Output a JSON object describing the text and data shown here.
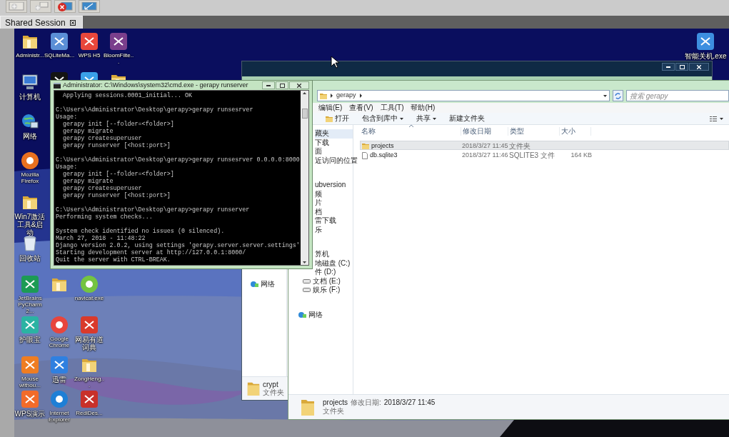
{
  "session_tabs": [
    {
      "label": "Shared Session",
      "selected": true
    }
  ],
  "desktop_icons": [
    {
      "label": "Administr...",
      "kind": "folder"
    },
    {
      "label": "SQLiteMa...",
      "kind": "tile",
      "color": "#5b8fd6"
    },
    {
      "label": "WPS H5",
      "kind": "tile",
      "color": "#e8473c"
    },
    {
      "label": "BloomFilte...",
      "kind": "tile",
      "color": "#7b3f8c"
    },
    {
      "label": "智能关机.exe",
      "kind": "tile",
      "color": "#3d8fe0"
    },
    {
      "label": "计算机",
      "kind": "computer"
    },
    {
      "kind": "tile",
      "color": "#141414"
    },
    {
      "kind": "tile",
      "color": "#3aa0e8"
    },
    {
      "kind": "folder"
    },
    {
      "label": "网络",
      "kind": "network"
    },
    {
      "label": "Mozilla Firefox",
      "kind": "round",
      "color": "#e8701f"
    },
    {
      "label": "Win7激活工具&启动",
      "kind": "folder"
    },
    {
      "label": "回收站",
      "kind": "recycle"
    },
    {
      "label": "JetBrains PyCharm 2...",
      "kind": "tile",
      "color": "#1c9b54"
    },
    {
      "kind": "folder"
    },
    {
      "label": "navicat.exe",
      "kind": "round",
      "color": "#74c441"
    },
    {
      "label": "护眼宝",
      "kind": "tile",
      "color": "#2bb3a3"
    },
    {
      "label": "Google Chrome",
      "kind": "round",
      "color": "#e8453c"
    },
    {
      "label": "网易有道词典",
      "kind": "tile",
      "color": "#d93a2b"
    },
    {
      "label": "Mouse withou...",
      "kind": "tile",
      "color": "#ef7d22"
    },
    {
      "label": "迅雷",
      "kind": "tile",
      "color": "#2f80e0"
    },
    {
      "label": "ZongHeng...",
      "kind": "folder"
    },
    {
      "label": "WPS演示",
      "kind": "tile",
      "color": "#f26b2a"
    },
    {
      "label": "Internet Explorer",
      "kind": "round",
      "color": "#1e7fd6"
    },
    {
      "label": "RediDes...",
      "kind": "tile",
      "color": "#c8312a"
    }
  ],
  "explorer_back": {
    "nav_items": [
      {
        "label": "网络",
        "kind": "network"
      }
    ],
    "details": {
      "name": "crypt",
      "type": "文件夹"
    }
  },
  "explorer": {
    "breadcrumb": [
      {
        "label": "gerapy"
      }
    ],
    "search": {
      "placeholder": "搜索 gerapy"
    },
    "menu": [
      "编辑(E)",
      "查看(V)",
      "工具(T)",
      "帮助(H)"
    ],
    "toolbar": [
      {
        "label": "打开",
        "kind": "open"
      },
      {
        "label": "包含到库中",
        "kind": "dropdown"
      },
      {
        "label": "共享",
        "kind": "dropdown"
      },
      {
        "label": "新建文件夹",
        "kind": "plain"
      }
    ],
    "nav_groups": [
      [
        {
          "label": "藏夹",
          "kind": "text",
          "selected": true
        },
        {
          "label": "下载",
          "kind": "text",
          "selected": false
        },
        {
          "label": "面",
          "kind": "text",
          "selected": false
        },
        {
          "label": "近访问的位置",
          "kind": "text",
          "selected": false
        }
      ],
      [
        {
          "label": "ubversion",
          "kind": "text",
          "selected": false
        },
        {
          "label": "频",
          "kind": "text",
          "selected": false
        },
        {
          "label": "片",
          "kind": "text",
          "selected": false
        },
        {
          "label": "档",
          "kind": "text",
          "selected": false
        },
        {
          "label": "雷下载",
          "kind": "text",
          "selected": false
        },
        {
          "label": "乐",
          "kind": "text",
          "selected": false
        }
      ],
      [
        {
          "label": "算机",
          "kind": "text",
          "selected": false
        },
        {
          "label": "地磁盘 (C:)",
          "kind": "text",
          "selected": false
        },
        {
          "label": "件 (D:)",
          "kind": "text",
          "selected": false
        },
        {
          "label": "文档 (E:)",
          "kind": "drive",
          "selected": false
        },
        {
          "label": "娱乐 (F:)",
          "kind": "drive",
          "selected": false
        }
      ],
      [
        {
          "label": "网络",
          "kind": "network",
          "selected": false
        }
      ]
    ],
    "columns": [
      "名称",
      "修改日期",
      "类型",
      "大小"
    ],
    "files": [
      {
        "name": "projects",
        "modified": "2018/3/27 11:45",
        "type": "文件夹",
        "kind": "folder",
        "selected": true
      },
      {
        "name": "db.sqlite3",
        "modified": "2018/3/27 11:46",
        "type": "SQLITE3 文件",
        "size": "164 KB",
        "kind": "file",
        "selected": false
      }
    ],
    "details": {
      "name": "projects",
      "modified_label": "修改日期:",
      "modified": "2018/3/27 11:45",
      "type": "文件夹"
    }
  },
  "cmd_window": {
    "title": "Administrator: C:\\Windows\\system32\\cmd.exe - gerapy runserver",
    "blocks": [
      [
        "  Applying sessions.0001_initial... OK"
      ],
      [
        "C:\\Users\\Administrator\\Desktop\\gerapy>gerapy runsesrver",
        "Usage:",
        "  gerapy init [--folder=<folder>]",
        "  gerapy migrate",
        "  gerapy createsuperuser",
        "  gerapy runserver [<host:port>]"
      ],
      [
        "C:\\Users\\Administrator\\Desktop\\gerapy>gerapy runsesrver 0.0.0.0:8000",
        "Usage:",
        "  gerapy init [--folder=<folder>]",
        "  gerapy migrate",
        "  gerapy createsuperuser",
        "  gerapy runserver [<host:port>]"
      ],
      [
        "C:\\Users\\Administrator\\Desktop\\gerapy>gerapy runserver",
        "Performing system checks..."
      ],
      [
        "System check identified no issues (0 silenced).",
        "March 27, 2018 - 11:48:22",
        "Django version 2.0.2, using settings 'gerapy.server.server.settings'",
        "Starting development server at http://127.0.0.1:8000/",
        "Quit the server with CTRL-BREAK."
      ]
    ]
  }
}
